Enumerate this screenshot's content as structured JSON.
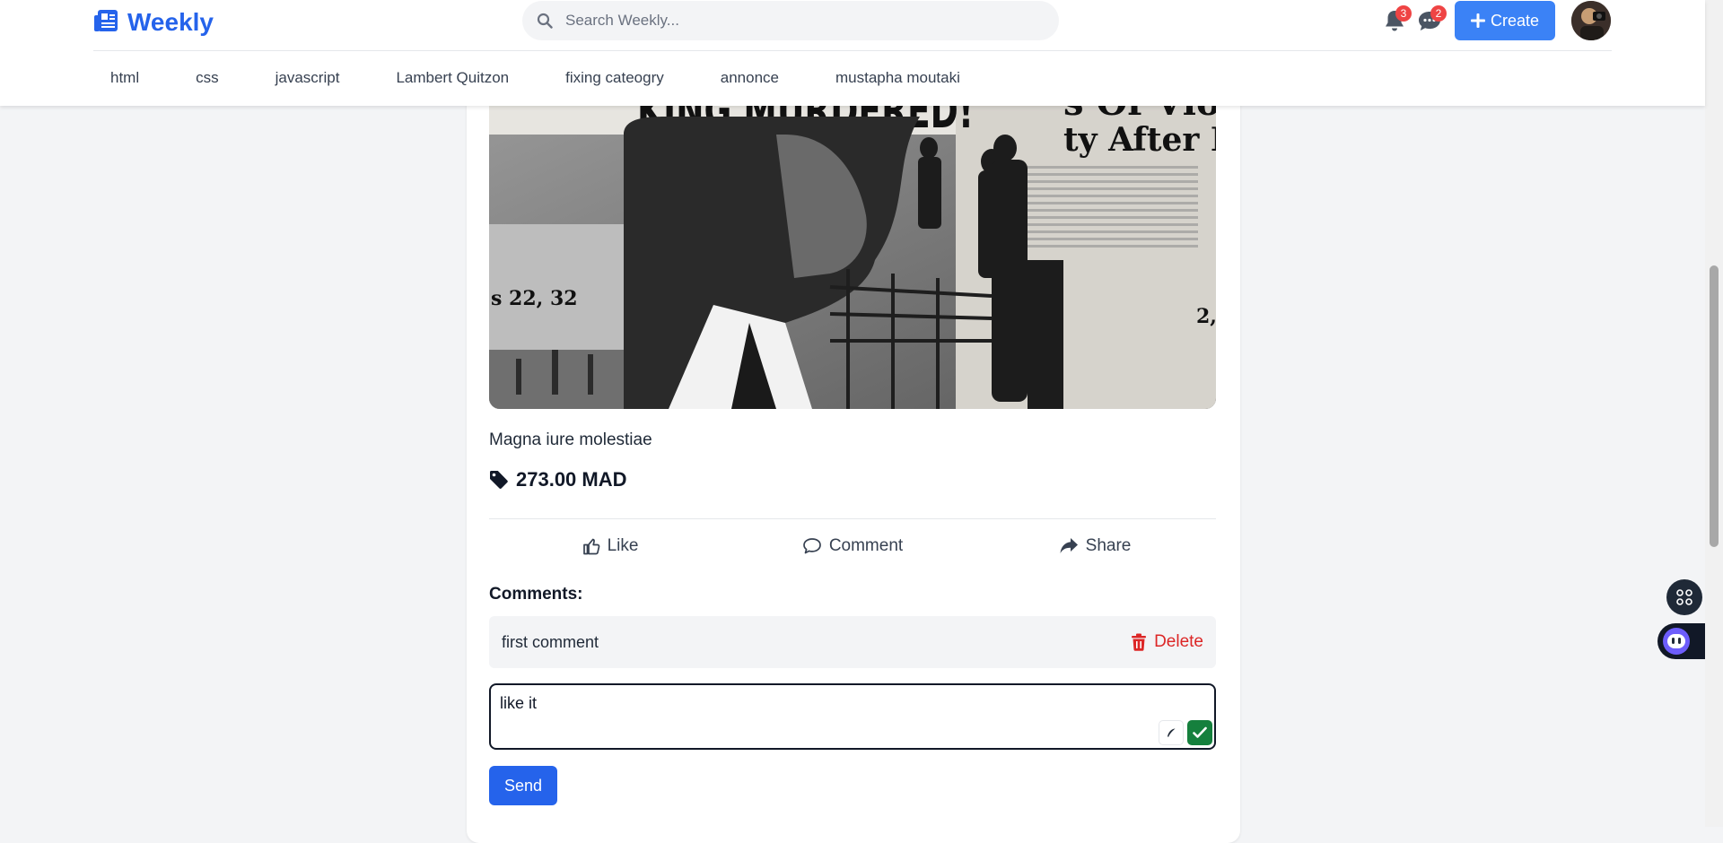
{
  "header": {
    "logo_text": "Weekly",
    "search_placeholder": "Search Weekly...",
    "notifications_count": "3",
    "messages_count": "2",
    "create_label": "Create",
    "accent_color": "#2563eb"
  },
  "nav": {
    "categories": [
      {
        "label": "html"
      },
      {
        "label": "css"
      },
      {
        "label": "javascript"
      },
      {
        "label": "Lambert Quitzon"
      },
      {
        "label": "fixing cateogry"
      },
      {
        "label": "annonce"
      },
      {
        "label": "mustapha moutaki"
      }
    ]
  },
  "post": {
    "image_headline_1": "KING MURDERED!",
    "image_headline_2": "s Of Violen",
    "image_headline_3": "ty After Ne",
    "image_caption_1": "s 22, 32",
    "image_caption_2": "2,",
    "title": "Magna iure molestiae",
    "price": "273.00 MAD",
    "actions": {
      "like": "Like",
      "comment": "Comment",
      "share": "Share"
    }
  },
  "comments": {
    "heading": "Comments:",
    "items": [
      {
        "text": "first comment",
        "delete_label": "Delete"
      }
    ],
    "input_value": "like it",
    "send_label": "Send"
  },
  "icons": {
    "logo": "newspaper-icon",
    "search": "search-icon",
    "notifications": "bell-icon",
    "messages": "chat-icon",
    "create": "plus-icon",
    "price": "tag-icon",
    "like": "thumbs-up-icon",
    "comment": "comment-icon",
    "share": "share-icon",
    "delete": "trash-icon"
  },
  "status_colors": {
    "badge": "#ef4444",
    "delete": "#dc2626",
    "send": "#2563eb",
    "create": "#3b82f6"
  }
}
